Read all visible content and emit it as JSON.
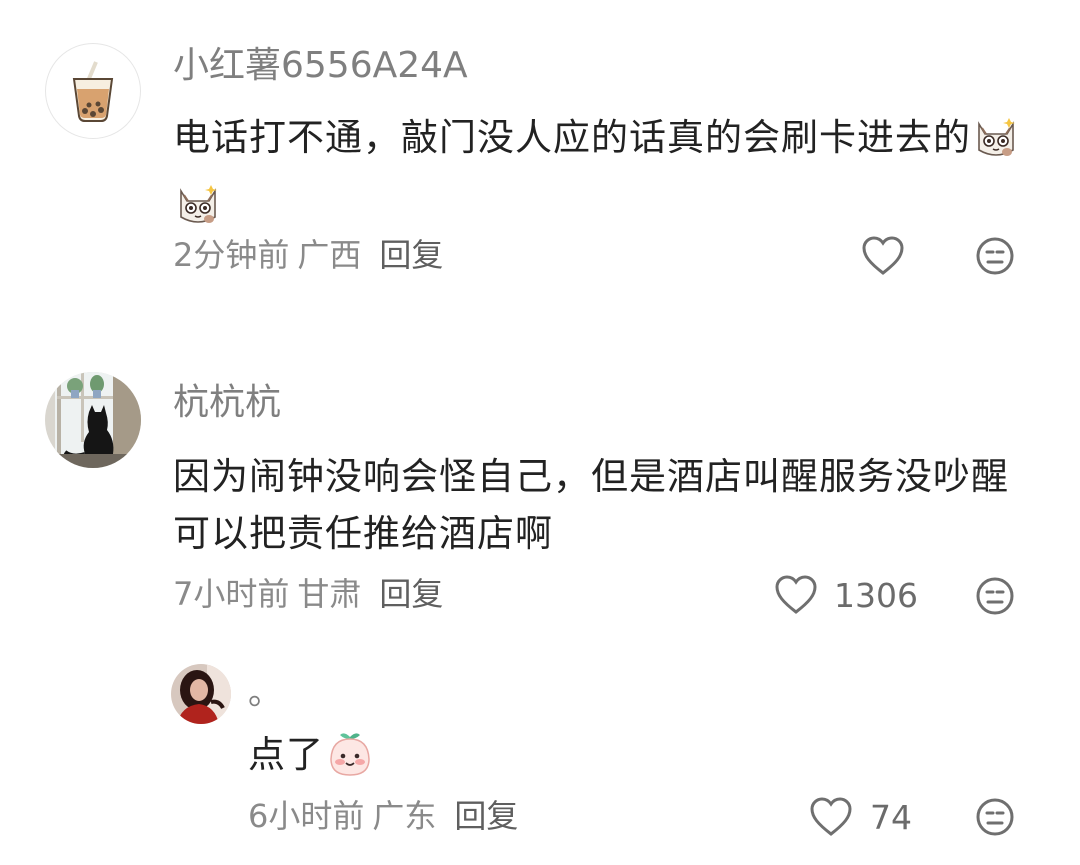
{
  "comments": [
    {
      "username": "小红薯6556A24A",
      "text": "电话打不通，敲门没人应的话真的会刷卡进去的",
      "time": "2分钟前",
      "location": "广西",
      "reply_label": "回复",
      "likes": "",
      "avatar_icon": "bubble-tea-icon",
      "emojis": [
        "peeking-cat-emoji-icon",
        "peeking-cat-emoji-icon"
      ]
    },
    {
      "username": "杭杭杭",
      "text": "因为闹钟没响会怪自己，但是酒店叫醒服务没吵醒可以把责任推给酒店啊",
      "time": "7小时前",
      "location": "甘肃",
      "reply_label": "回复",
      "likes": "1306",
      "avatar_icon": "window-cat-photo"
    }
  ],
  "reply": {
    "username": "。",
    "text": "点了",
    "time": "6小时前",
    "location": "广东",
    "reply_label": "回复",
    "likes": "74",
    "avatar_icon": "profile-photo",
    "emoji": "shy-peach-emoji-icon"
  },
  "colors": {
    "text": "#222222",
    "muted": "#8a8a8a",
    "icon": "#6f6f6f"
  }
}
